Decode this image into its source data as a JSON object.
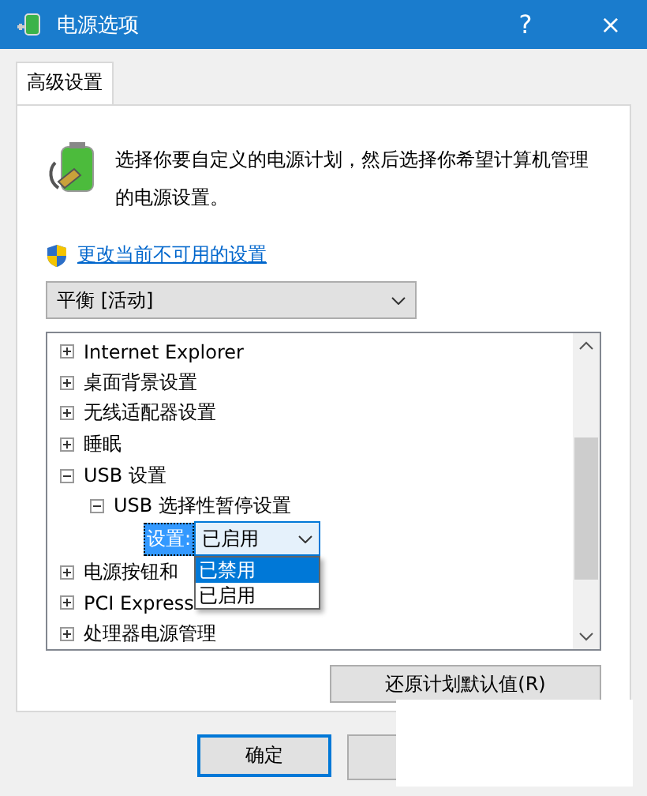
{
  "window": {
    "title": "电源选项",
    "help_button": "?",
    "close_button": "×"
  },
  "tabs": [
    {
      "label": "高级设置",
      "selected": true
    }
  ],
  "description": "选择你要自定义的电源计划，然后选择你希望计算机管理的电源设置。",
  "admin_link": "更改当前不可用的设置",
  "plan_select": {
    "value": "平衡 [活动]"
  },
  "tree": [
    {
      "kind": "group",
      "label": "Internet Explorer",
      "expanded": false
    },
    {
      "kind": "group",
      "label": "桌面背景设置",
      "expanded": false
    },
    {
      "kind": "group",
      "label": "无线适配器设置",
      "expanded": false
    },
    {
      "kind": "group",
      "label": "睡眠",
      "expanded": false
    },
    {
      "kind": "group",
      "label": "USB 设置",
      "expanded": true,
      "children": [
        {
          "kind": "group",
          "label": "USB 选择性暂停设置",
          "expanded": true,
          "children": [
            {
              "kind": "setting",
              "label": "设置:",
              "value": "已启用",
              "expanded": true,
              "options": [
                {
                  "label": "已禁用",
                  "highlighted": true
                },
                {
                  "label": "已启用",
                  "highlighted": false
                }
              ]
            }
          ]
        }
      ]
    },
    {
      "kind": "group",
      "label": "电源按钮和",
      "expanded": false
    },
    {
      "kind": "group",
      "label": "PCI Express",
      "expanded": false
    },
    {
      "kind": "group",
      "label": "处理器电源管理",
      "expanded": false
    }
  ],
  "restore_button": "还原计划默认值(R)",
  "ok_button": "确定"
}
